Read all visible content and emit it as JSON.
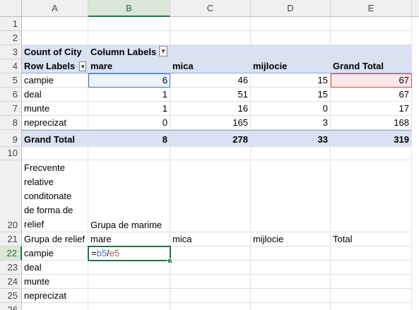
{
  "columns": [
    "A",
    "B",
    "C",
    "D",
    "E"
  ],
  "rows": {
    "r1": "1",
    "r2": "2",
    "r3": "3",
    "r4": "4",
    "r5": "5",
    "r6": "6",
    "r7": "7",
    "r8": "8",
    "r9": "9",
    "r10": "10",
    "r20": "20",
    "r21": "21",
    "r22": "22",
    "r23": "23",
    "r24": "24",
    "r25": "25",
    "r26": "26"
  },
  "pivot": {
    "value_label": "Count of City",
    "column_labels": "Column Labels",
    "row_labels": "Row Labels",
    "col_mare": "mare",
    "col_mica": "mica",
    "col_mijlocie": "mijlocie",
    "col_grand_total": "Grand Total",
    "rows": [
      {
        "label": "campie",
        "mare": "6",
        "mica": "46",
        "mijlocie": "15",
        "total": "67"
      },
      {
        "label": "deal",
        "mare": "1",
        "mica": "51",
        "mijlocie": "15",
        "total": "67"
      },
      {
        "label": "munte",
        "mare": "1",
        "mica": "16",
        "mijlocie": "0",
        "total": "17"
      },
      {
        "label": "neprecizat",
        "mare": "0",
        "mica": "165",
        "mijlocie": "3",
        "total": "168"
      }
    ],
    "grand": {
      "label": "Grand Total",
      "mare": "8",
      "mica": "278",
      "mijlocie": "33",
      "total": "319"
    }
  },
  "table2": {
    "title_lines": [
      "Frecvente",
      "relative",
      "conditonate",
      "de forma de",
      "relief"
    ],
    "group_label": "Grupa de marime",
    "header": {
      "a": "Grupa de relief",
      "b": "mare",
      "c": "mica",
      "d": "mijlocie",
      "e": "Total"
    },
    "rows": [
      "campie",
      "deal",
      "munte",
      "neprecizat"
    ],
    "formula": {
      "eq": "=",
      "ref1": "b5",
      "op": "/",
      "ref2": "e5"
    }
  },
  "colors": {
    "accent": "#217346",
    "pivot_header": "#d9e1f2",
    "ref_blue": "#4472c4",
    "ref_red": "#c0504d"
  }
}
